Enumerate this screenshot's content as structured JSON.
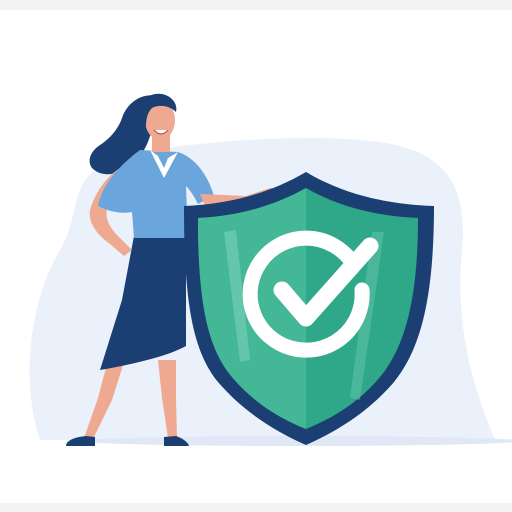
{
  "illustration": {
    "subject": "woman-with-security-shield",
    "icons": [
      "shield-icon",
      "checkmark-icon"
    ],
    "colors": {
      "background": "#ffffff",
      "frame_band": "#f3f3f4",
      "backdrop_blob": "#eaf1fb",
      "shield_outline": "#1c3f73",
      "shield_fill": "#2fa88a",
      "shield_fill_light": "#6fcfb2",
      "check_ring": "#ffffff",
      "hair": "#1c3f73",
      "skin": "#f0a991",
      "blouse": "#6aa6dc",
      "skirt": "#1c3f73",
      "shoes": "#1c3f73"
    }
  }
}
